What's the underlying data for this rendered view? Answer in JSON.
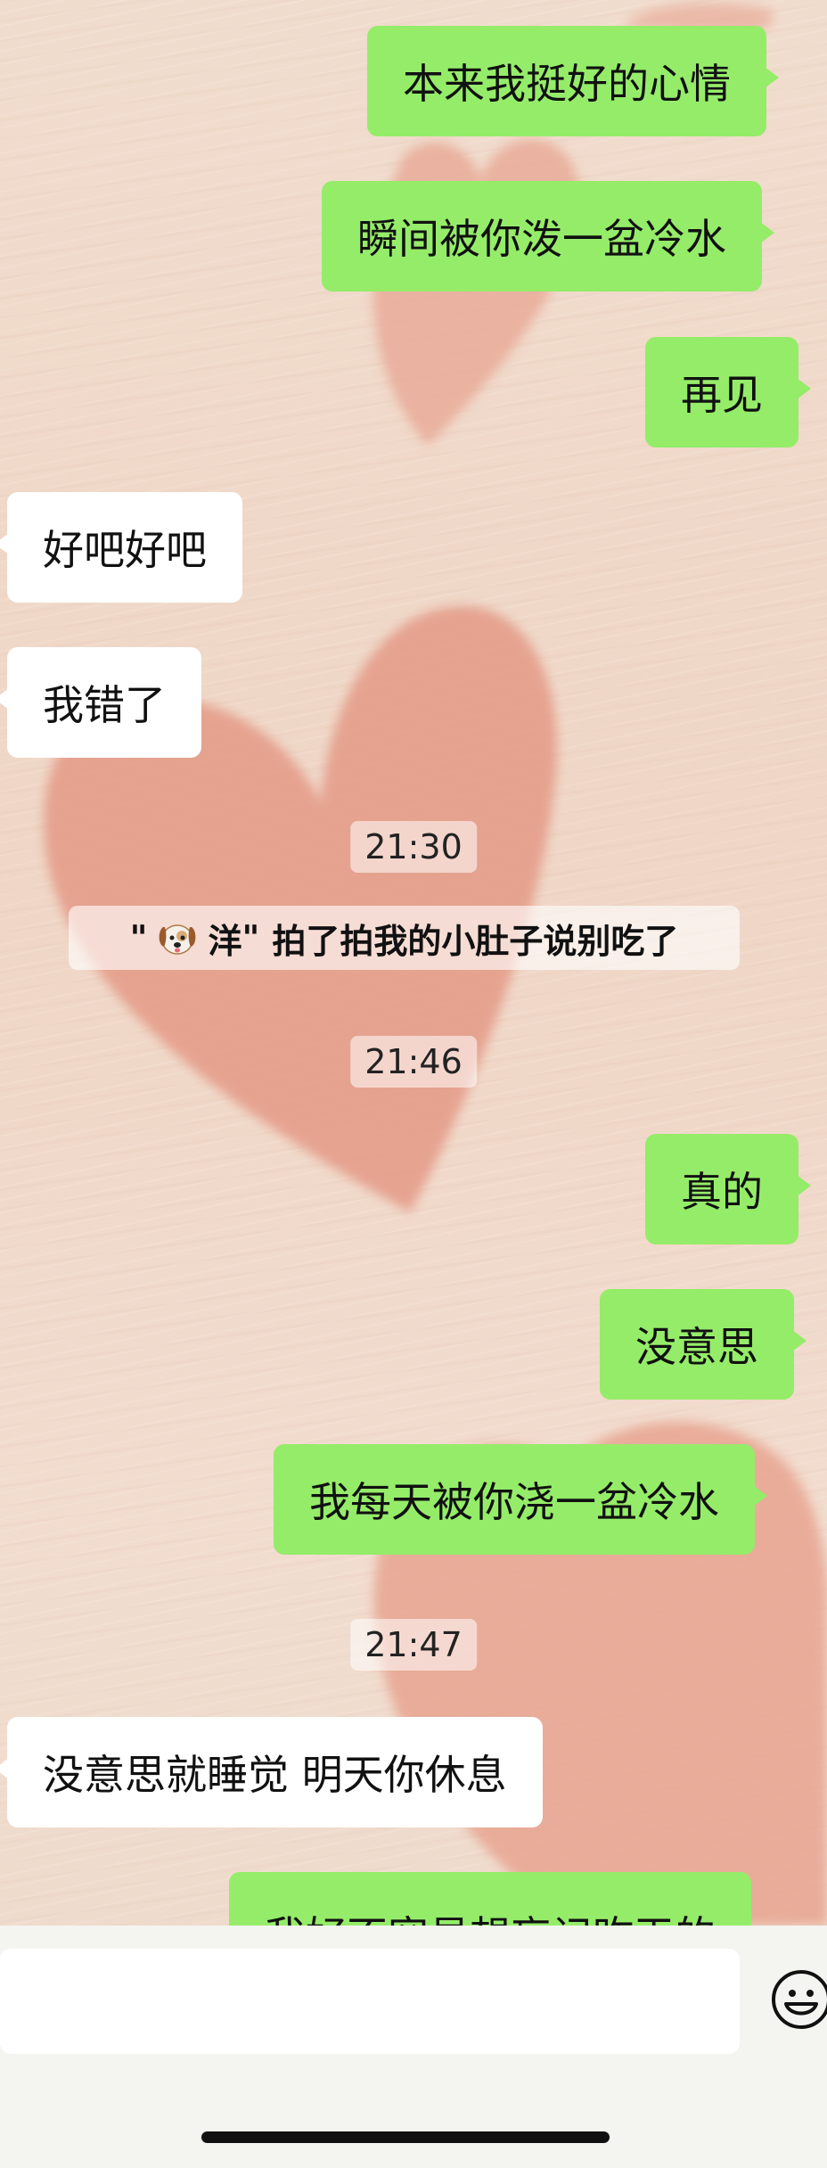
{
  "messages": [
    {
      "side": "me",
      "text": "本来我挺好的心情"
    },
    {
      "side": "me",
      "text": "瞬间被你泼一盆冷水"
    },
    {
      "side": "me",
      "text": "再见"
    },
    {
      "side": "them",
      "text": "好吧好吧"
    },
    {
      "side": "them",
      "text": "我错了"
    },
    {
      "side": "me",
      "text": "真的"
    },
    {
      "side": "me",
      "text": "没意思"
    },
    {
      "side": "me",
      "text": "我每天被你浇一盆冷水"
    },
    {
      "side": "them",
      "text": "没意思就睡觉  明天你休息"
    },
    {
      "side": "me",
      "text": "我好不容易想忘记昨天的"
    }
  ],
  "timestamps": [
    "21:30",
    "21:46",
    "21:47"
  ],
  "system_message": {
    "quote_open": "\"",
    "name": "洋",
    "quote_close": "\"",
    "text": "拍了拍我的小肚子说别吃了"
  },
  "icons": {
    "emoji_button": "smiley-face-icon",
    "avatar_emoji": "dog-face-icon"
  },
  "colors": {
    "my_bubble": "#95ec69",
    "their_bubble": "#ffffff",
    "background": "#f0dccd"
  }
}
